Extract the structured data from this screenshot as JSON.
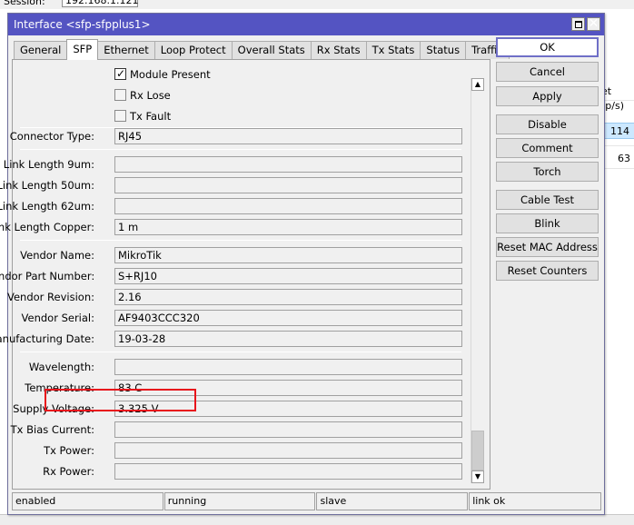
{
  "background": {
    "session_label": "Session:",
    "session_value": "192.168.1.121",
    "col_header": "et (p/s)",
    "row_values": [
      "114",
      "63"
    ]
  },
  "dialog": {
    "title": "Interface <sfp-sfpplus1>",
    "tabs": [
      "General",
      "SFP",
      "Ethernet",
      "Loop Protect",
      "Overall Stats",
      "Rx Stats",
      "Tx Stats",
      "Status",
      "Traffic"
    ],
    "active_tab": "SFP"
  },
  "checkboxes": [
    {
      "label": "Module Present",
      "checked": true
    },
    {
      "label": "Rx Lose",
      "checked": false
    },
    {
      "label": "Tx Fault",
      "checked": false
    }
  ],
  "fields": {
    "connector_type": {
      "label": "Connector Type:",
      "value": "RJ45"
    },
    "link_length_9um": {
      "label": "Link Length 9um:",
      "value": ""
    },
    "link_length_50um": {
      "label": "Link Length 50um:",
      "value": ""
    },
    "link_length_62um": {
      "label": "Link Length 62um:",
      "value": ""
    },
    "link_length_copper": {
      "label": "Link Length Copper:",
      "value": "1 m"
    },
    "vendor_name": {
      "label": "Vendor Name:",
      "value": "MikroTik"
    },
    "vendor_part_number": {
      "label": "Vendor Part Number:",
      "value": "S+RJ10"
    },
    "vendor_revision": {
      "label": "Vendor Revision:",
      "value": "2.16"
    },
    "vendor_serial": {
      "label": "Vendor Serial:",
      "value": "AF9403CCC320"
    },
    "manufacturing_date": {
      "label": "Manufacturing Date:",
      "value": "19-03-28"
    },
    "wavelength": {
      "label": "Wavelength:",
      "value": ""
    },
    "temperature": {
      "label": "Temperature:",
      "value": "83 C"
    },
    "supply_voltage": {
      "label": "Supply Voltage:",
      "value": "3.325 V"
    },
    "tx_bias_current": {
      "label": "Tx Bias Current:",
      "value": ""
    },
    "tx_power": {
      "label": "Tx Power:",
      "value": ""
    },
    "rx_power": {
      "label": "Rx Power:",
      "value": ""
    }
  },
  "buttons": {
    "ok": "OK",
    "cancel": "Cancel",
    "apply": "Apply",
    "disable": "Disable",
    "comment": "Comment",
    "torch": "Torch",
    "cable_test": "Cable Test",
    "blink": "Blink",
    "reset_mac": "Reset MAC Address",
    "reset_counters": "Reset Counters"
  },
  "status": {
    "state": "enabled",
    "running": "running",
    "role": "slave",
    "link": "link ok"
  },
  "colors": {
    "titlebar": "#5454c2",
    "highlight": "#e8141b",
    "selected_row": "#cce8ff"
  }
}
